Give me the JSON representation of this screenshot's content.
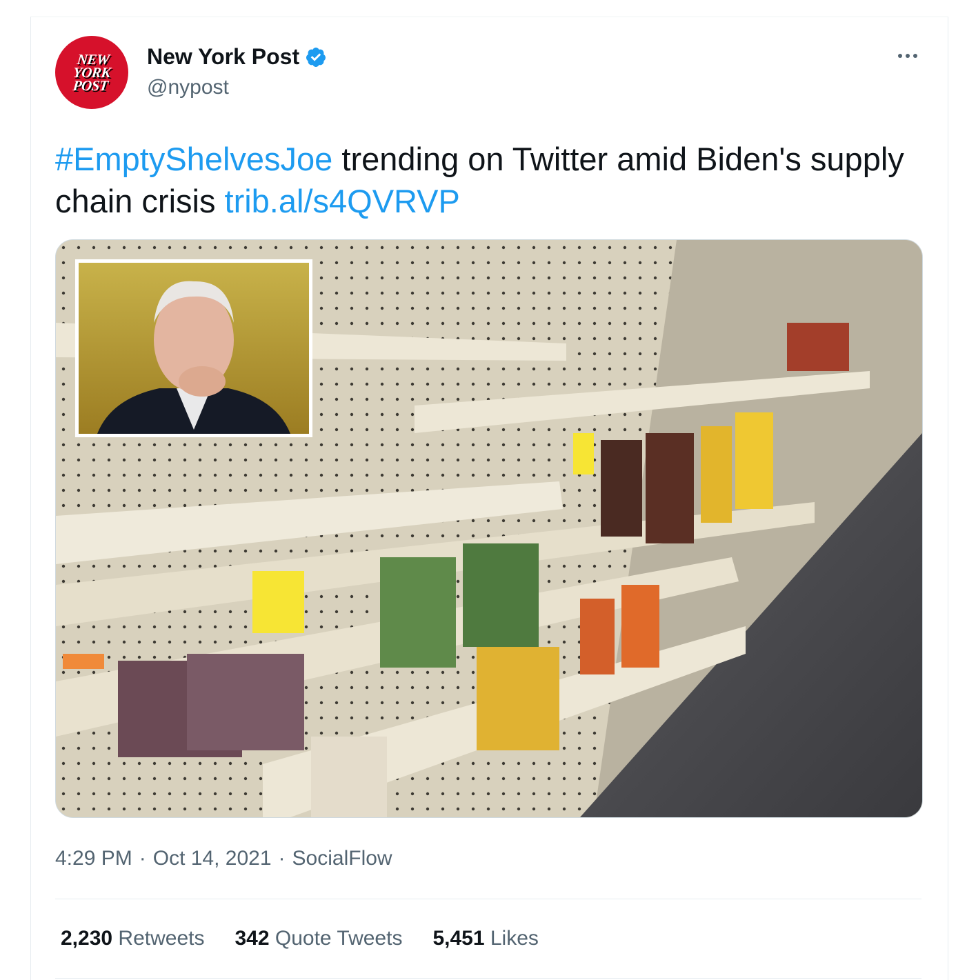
{
  "account": {
    "display_name": "New York Post",
    "handle": "@nypost",
    "avatar_logo_text": "NEW YORK POST",
    "verified_icon": "verified-badge-icon"
  },
  "tweet": {
    "hashtag": "#EmptyShelvesJoe",
    "text_middle": " trending on Twitter amid Biden's supply chain crisis ",
    "link": "trib.al/s4QVRVP"
  },
  "meta": {
    "time": "4:29 PM",
    "separator": "·",
    "date": "Oct 14, 2021",
    "source": "SocialFlow"
  },
  "stats": {
    "retweets_count": "2,230",
    "retweets_label": "Retweets",
    "quotes_count": "342",
    "quotes_label": "Quote Tweets",
    "likes_count": "5,451",
    "likes_label": "Likes"
  },
  "colors": {
    "link": "#1d9bf0",
    "brand_red": "#d6112b",
    "secondary_text": "#536471"
  }
}
